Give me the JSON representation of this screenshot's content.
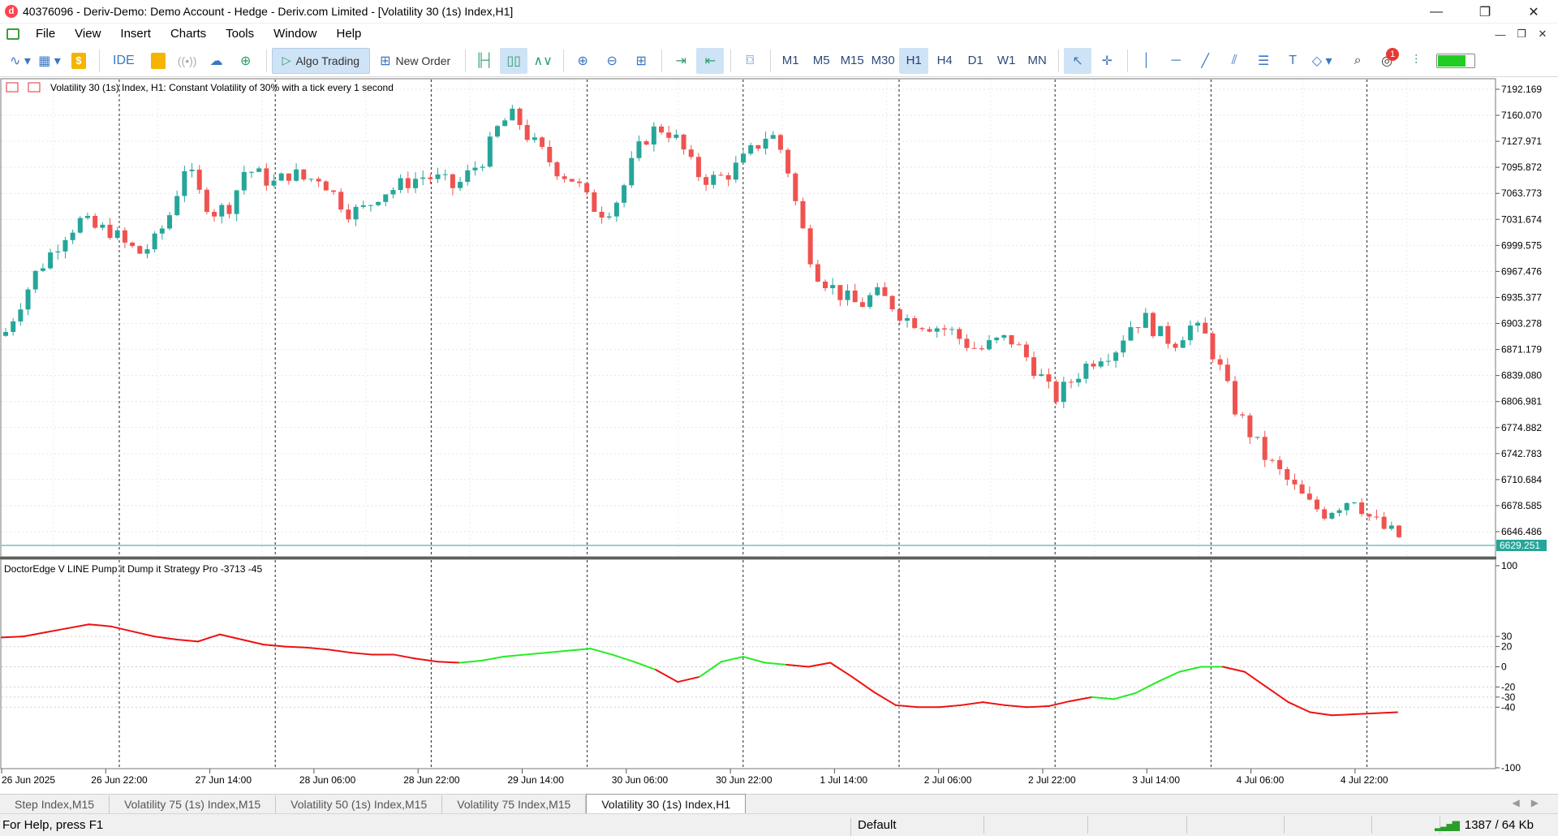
{
  "window": {
    "title": "40376096 - Deriv-Demo: Demo Account - Hedge - Deriv.com Limited - [Volatility 30 (1s) Index,H1]",
    "minimize": "—",
    "restore": "❐",
    "close": "✕"
  },
  "menu": {
    "items": [
      "File",
      "View",
      "Insert",
      "Charts",
      "Tools",
      "Window",
      "Help"
    ],
    "mdi": [
      "—",
      "❐",
      "✕"
    ]
  },
  "toolbar": {
    "ide_label": "IDE",
    "algo_label": "Algo Trading",
    "new_order_label": "New Order",
    "timeframes": [
      "M1",
      "M5",
      "M15",
      "M30",
      "H1",
      "H4",
      "D1",
      "W1",
      "MN"
    ],
    "active_timeframe": "H1",
    "notification_count": "1"
  },
  "chart": {
    "main_label": "Volatility 30 (1s) Index, H1:  Constant Volatility of 30% with a tick every 1 second",
    "indicator_label": "DoctorEdge V LINE Pump it Dump it Strategy Pro -3713 -45",
    "current_price_label": "6629.251",
    "up_color": "#26a69a",
    "down_color": "#ef5350",
    "indicator_up_color": "#22ee22",
    "indicator_down_color": "#ee1111",
    "price_ticks": [
      "7192.169",
      "7160.070",
      "7127.971",
      "7095.872",
      "7063.773",
      "7031.674",
      "6999.575",
      "6967.476",
      "6935.377",
      "6903.278",
      "6871.179",
      "6839.080",
      "6806.981",
      "6774.882",
      "6742.783",
      "6710.684",
      "6678.585",
      "6646.486"
    ],
    "indicator_ticks": [
      "100",
      "30",
      "20",
      "0",
      "-20",
      "-30",
      "-40",
      "-100"
    ],
    "time_labels": [
      "26 Jun 2025",
      "26 Jun 22:00",
      "27 Jun 14:00",
      "28 Jun 06:00",
      "28 Jun 22:00",
      "29 Jun 14:00",
      "30 Jun 06:00",
      "30 Jun 22:00",
      "1 Jul 14:00",
      "2 Jul 06:00",
      "2 Jul 22:00",
      "3 Jul 14:00",
      "4 Jul 06:00",
      "4 Jul 22:00"
    ]
  },
  "chart_data": {
    "type": "candlestick",
    "price_range": [
      6629.251,
      7192.169
    ],
    "close_waypoints": [
      6893,
      6930,
      6965,
      6990,
      7015,
      7030,
      7020,
      7018,
      7000,
      6990,
      7005,
      7040,
      7100,
      7060,
      7040,
      7050,
      7095,
      7085,
      7075,
      7090,
      7080,
      7085,
      7060,
      7040,
      7045,
      7065,
      7070,
      7080,
      7085,
      7080,
      7070,
      7090,
      7110,
      7150,
      7160,
      7130,
      7110,
      7090,
      7080,
      7050,
      7040,
      7060,
      7110,
      7140,
      7145,
      7125,
      7090,
      7080,
      7085,
      7100,
      7120,
      7140,
      7110,
      7030,
      6970,
      6950,
      6935,
      6925,
      6940,
      6930,
      6910,
      6905,
      6900,
      6895,
      6880,
      6870,
      6880,
      6885,
      6865,
      6840,
      6810,
      6830,
      6850,
      6865,
      6870,
      6900,
      6910,
      6890,
      6880,
      6900,
      6890,
      6850,
      6800,
      6770,
      6740,
      6720,
      6700,
      6680,
      6670,
      6680,
      6690,
      6665,
      6650,
      6640
    ],
    "indicator_series": [
      29,
      30,
      34,
      38,
      42,
      40,
      35,
      30,
      27,
      25,
      32,
      27,
      22,
      20,
      19,
      17,
      14,
      12,
      12,
      8,
      5,
      4,
      6,
      10,
      12,
      14,
      16,
      18,
      12,
      5,
      -3,
      -15,
      -10,
      5,
      10,
      4,
      2,
      0,
      4,
      -10,
      -25,
      -38,
      -40,
      -40,
      -38,
      -35,
      -38,
      -40,
      -39,
      -34,
      -30,
      -32,
      -26,
      -15,
      -5,
      0,
      0,
      -5,
      -20,
      -35,
      -45,
      -48,
      -47,
      -46,
      -45
    ],
    "indicator_up_ranges": [
      [
        21,
        30
      ],
      [
        32,
        36
      ],
      [
        50,
        56
      ]
    ]
  },
  "tabs": {
    "items": [
      "Step Index,M15",
      "Volatility 75 (1s) Index,M15",
      "Volatility 50 (1s) Index,M15",
      "Volatility 75 Index,M15",
      "Volatility 30 (1s) Index,H1"
    ],
    "active_index": 4,
    "scroll_left": "◀",
    "scroll_right": "▶"
  },
  "status": {
    "help": "For Help, press F1",
    "profile": "Default",
    "traffic": "1387 / 64 Kb"
  }
}
